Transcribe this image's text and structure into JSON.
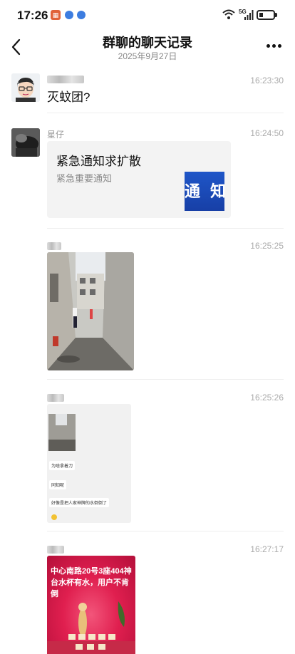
{
  "status_bar": {
    "time": "17:26",
    "network": "5G"
  },
  "header": {
    "title": "群聊的聊天记录",
    "date": "2025年9月27日"
  },
  "messages": [
    {
      "sender": "",
      "time": "16:23:30",
      "text": "灭蚊团?"
    },
    {
      "sender": "星仔",
      "time": "16:24:50",
      "card": {
        "title": "紧急通知求扩散",
        "description": "紧急重要通知",
        "thumb_text": "通 知"
      }
    },
    {
      "sender": "",
      "time": "16:25:25",
      "image": "alley-photo"
    },
    {
      "sender": "",
      "time": "16:25:26",
      "image": "chat-screenshot",
      "screenshot_lines": [
        "为啥拿着刀",
        "同知呢",
        "好像是把人家神牌的水倒倒了"
      ]
    },
    {
      "sender": "",
      "time": "16:27:17",
      "image": "shrine-photo",
      "caption": "中心南路20号3座404神台水杯有水，用户不肯倒"
    }
  ],
  "colors": {
    "card_bg": "#f3f3f3",
    "thumb_blue": "#1f56c8",
    "shrine_red": "#e01f4f"
  }
}
